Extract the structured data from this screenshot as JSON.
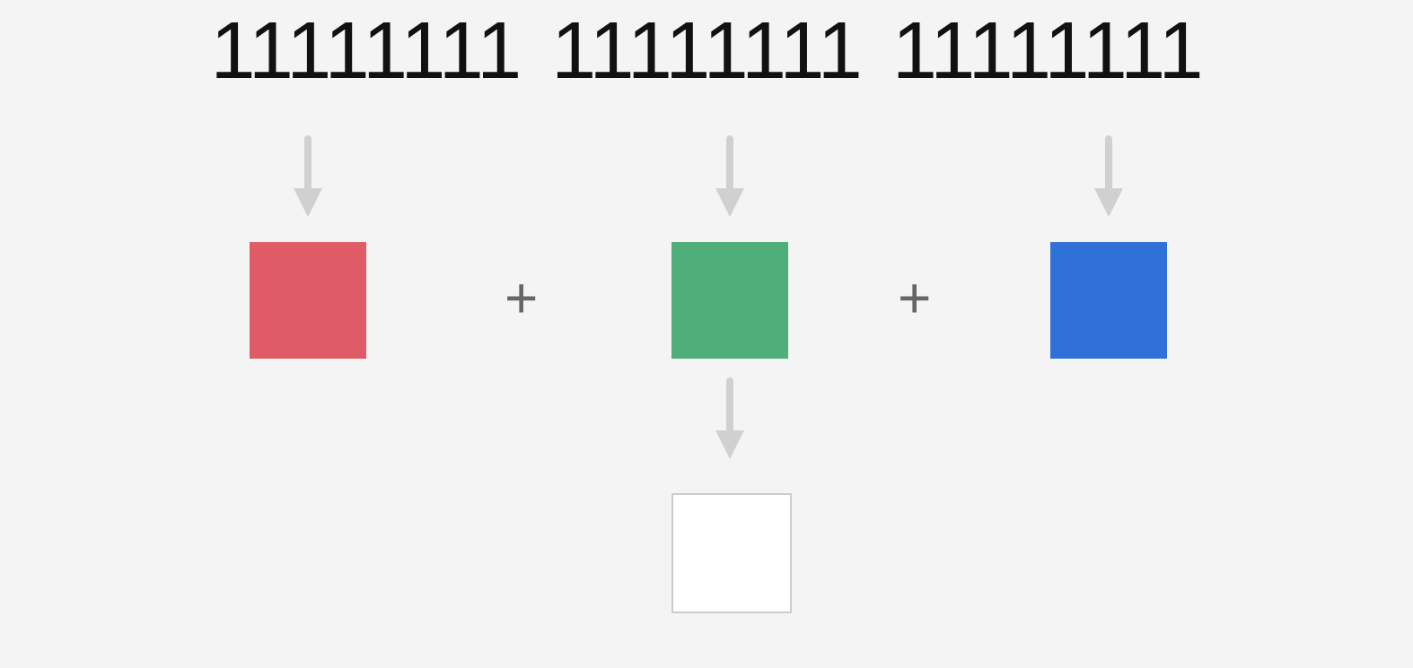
{
  "bytes": {
    "r": "11111111",
    "g": "11111111",
    "b": "11111111"
  },
  "operators": {
    "plus1": "+",
    "plus2": "+"
  },
  "colors": {
    "red": "#df5b66",
    "green": "#50ae78",
    "blue": "#2f71d8",
    "result": "#ffffff",
    "arrow": "#d0d0d0",
    "plus": "#666666"
  }
}
